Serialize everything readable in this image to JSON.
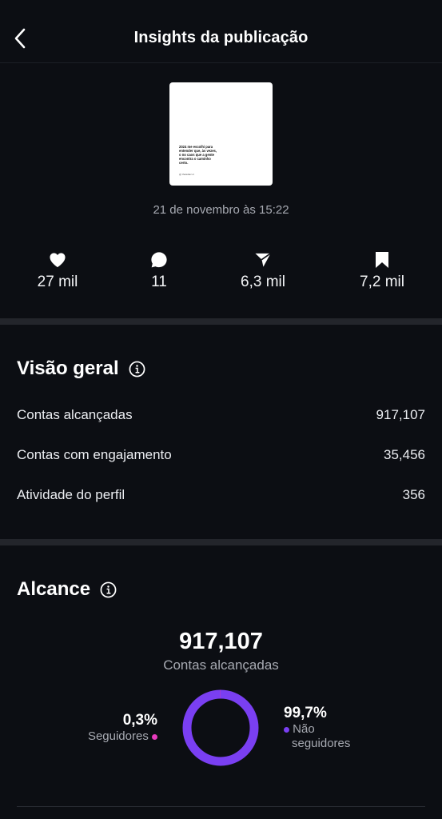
{
  "header": {
    "title": "Insights da publicação"
  },
  "post": {
    "thumbnail_text": "2024 me escolhi para entender que, às vezes, o no caos que a gente encontra o caminho certo.",
    "thumbnail_handle": "@ thaisdiaz.ct",
    "date": "21 de novembro às 15:22"
  },
  "metrics": {
    "likes": "27 mil",
    "comments": "11",
    "shares": "6,3 mil",
    "saves": "7,2 mil"
  },
  "overview": {
    "title": "Visão geral",
    "rows": [
      {
        "label": "Contas alcançadas",
        "value": "917,107"
      },
      {
        "label": "Contas com engajamento",
        "value": "35,456"
      },
      {
        "label": "Atividade do perfil",
        "value": "356"
      }
    ]
  },
  "reach": {
    "title": "Alcance",
    "total": "917,107",
    "total_label": "Contas alcançadas",
    "followers_pct": "0,3%",
    "followers_label": "Seguidores",
    "non_followers_pct": "99,7%",
    "non_followers_label_1": "Não",
    "non_followers_label_2": "seguidores",
    "followers_fraction": 0.003,
    "non_followers_fraction": 0.997
  },
  "colors": {
    "background": "#0c0e13",
    "followers": "#e83bbd",
    "non_followers": "#7a3ff2",
    "muted_text": "#a7aab2"
  },
  "icons": {
    "back": "chevron-left-icon",
    "likes": "heart-icon",
    "comments": "comment-icon",
    "shares": "send-icon",
    "saves": "bookmark-icon",
    "info": "info-icon"
  }
}
